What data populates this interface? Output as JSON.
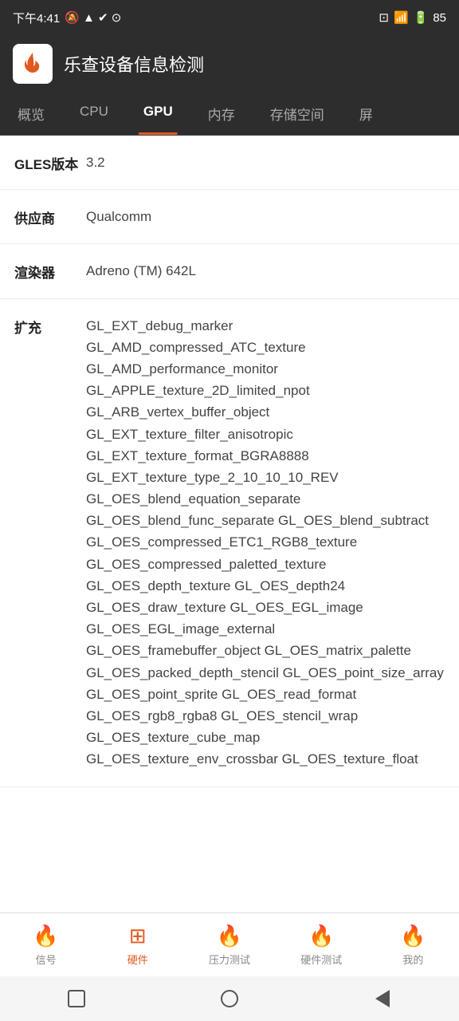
{
  "statusBar": {
    "time": "下午4:41",
    "battery": "85"
  },
  "appBar": {
    "title": "乐查设备信息检测"
  },
  "tabs": [
    {
      "id": "overview",
      "label": "概览",
      "active": false
    },
    {
      "id": "cpu",
      "label": "CPU",
      "active": false
    },
    {
      "id": "gpu",
      "label": "GPU",
      "active": true
    },
    {
      "id": "memory",
      "label": "内存",
      "active": false
    },
    {
      "id": "storage",
      "label": "存储空间",
      "active": false
    },
    {
      "id": "other",
      "label": "屏",
      "active": false
    }
  ],
  "rows": [
    {
      "label": "GLES版本",
      "value": "3.2"
    },
    {
      "label": "供应商",
      "value": "Qualcomm"
    },
    {
      "label": "渲染器",
      "value": "Adreno (TM) 642L"
    },
    {
      "label": "扩充",
      "value": "GL_EXT_debug_marker GL_AMD_compressed_ATC_texture GL_AMD_performance_monitor GL_APPLE_texture_2D_limited_npot GL_ARB_vertex_buffer_object GL_EXT_texture_filter_anisotropic GL_EXT_texture_format_BGRA8888 GL_EXT_texture_type_2_10_10_10_REV GL_OES_blend_equation_separate GL_OES_blend_func_separate GL_OES_blend_subtract GL_OES_compressed_ETC1_RGB8_texture GL_OES_compressed_paletted_texture GL_OES_depth_texture GL_OES_depth24 GL_OES_draw_texture GL_OES_EGL_image GL_OES_EGL_image_external GL_OES_framebuffer_object GL_OES_matrix_palette GL_OES_packed_depth_stencil GL_OES_point_size_array GL_OES_point_sprite GL_OES_read_format GL_OES_rgb8_rgba8 GL_OES_stencil_wrap GL_OES_texture_cube_map GL_OES_texture_env_crossbar GL_OES_texture_float"
    }
  ],
  "bottomNav": [
    {
      "id": "signal",
      "label": "信号",
      "active": false
    },
    {
      "id": "hardware",
      "label": "硬件",
      "active": true
    },
    {
      "id": "stress",
      "label": "压力测试",
      "active": false
    },
    {
      "id": "hwtest",
      "label": "硬件测试",
      "active": false
    },
    {
      "id": "me",
      "label": "我的",
      "active": false
    }
  ]
}
